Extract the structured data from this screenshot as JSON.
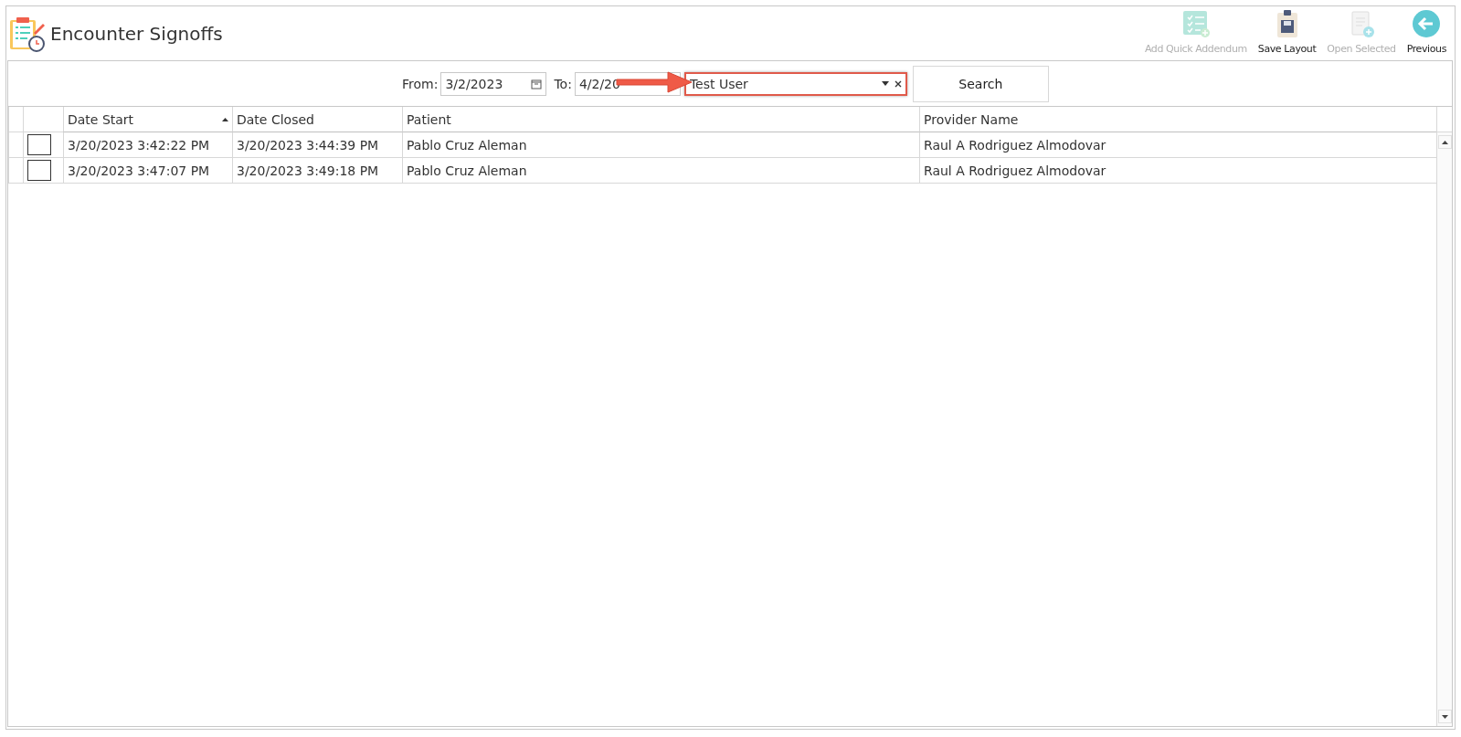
{
  "title": "Encounter Signoffs",
  "toolbar": [
    {
      "label": "Add Quick Addendum",
      "kind": "addendum",
      "disabled": true
    },
    {
      "label": "Save Layout",
      "kind": "save",
      "disabled": false
    },
    {
      "label": "Open Selected",
      "kind": "open",
      "disabled": true
    },
    {
      "label": "Previous",
      "kind": "back",
      "disabled": false
    }
  ],
  "filter": {
    "from_label": "From:",
    "from_value": "3/2/2023",
    "to_label": "To:",
    "to_value": "4/2/20",
    "user_value": "Test User",
    "search": "Search"
  },
  "columns": [
    {
      "label": "Date Start",
      "sorted": true
    },
    {
      "label": "Date Closed",
      "sorted": false
    },
    {
      "label": "Patient",
      "sorted": false
    },
    {
      "label": "Provider Name",
      "sorted": false
    }
  ],
  "rows": [
    {
      "checked": false,
      "cells": [
        "3/20/2023 3:42:22 PM",
        "3/20/2023 3:44:39 PM",
        "Pablo Cruz Aleman",
        "Raul A Rodriguez Almodovar"
      ]
    },
    {
      "checked": false,
      "cells": [
        "3/20/2023 3:47:07 PM",
        "3/20/2023 3:49:18 PM",
        "Pablo Cruz Aleman",
        "Raul A Rodriguez Almodovar"
      ]
    }
  ]
}
